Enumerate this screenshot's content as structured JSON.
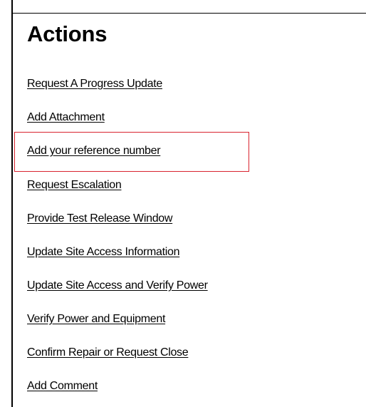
{
  "panel": {
    "title": "Actions",
    "highlight_color": "#d9242f"
  },
  "actions": [
    {
      "label": "Request A Progress Update"
    },
    {
      "label": "Add Attachment"
    },
    {
      "label": "Add your reference number",
      "highlighted": true
    },
    {
      "label": "Request Escalation"
    },
    {
      "label": "Provide Test Release Window"
    },
    {
      "label": "Update Site Access Information"
    },
    {
      "label": "Update Site Access and Verify Power"
    },
    {
      "label": "Verify Power and Equipment"
    },
    {
      "label": "Confirm Repair or Request Close"
    },
    {
      "label": "Add Comment"
    }
  ]
}
